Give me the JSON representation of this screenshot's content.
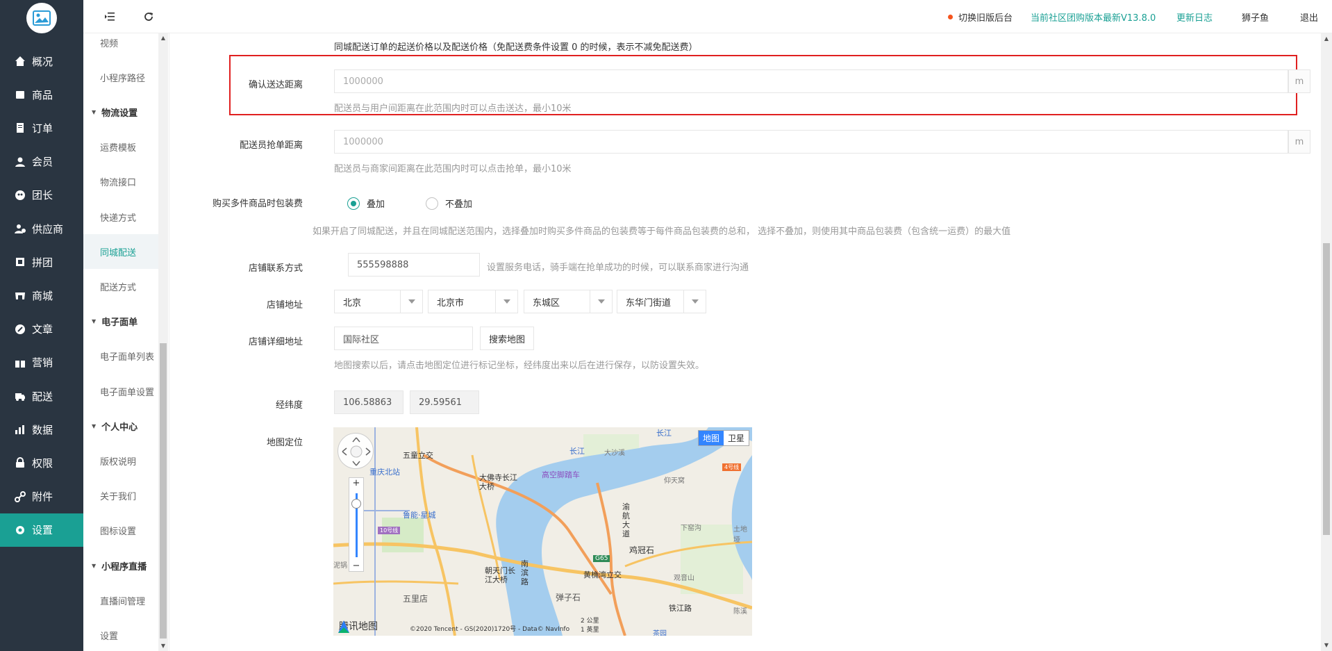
{
  "sidebar": {
    "items": [
      {
        "label": "概况",
        "icon": "home-icon"
      },
      {
        "label": "商品",
        "icon": "goods-icon"
      },
      {
        "label": "订单",
        "icon": "order-icon"
      },
      {
        "label": "会员",
        "icon": "user-icon"
      },
      {
        "label": "团长",
        "icon": "leader-icon"
      },
      {
        "label": "供应商",
        "icon": "supplier-icon"
      },
      {
        "label": "拼团",
        "icon": "group-icon"
      },
      {
        "label": "商城",
        "icon": "store-icon"
      },
      {
        "label": "文章",
        "icon": "article-icon"
      },
      {
        "label": "营销",
        "icon": "gift-icon"
      },
      {
        "label": "配送",
        "icon": "truck-icon"
      },
      {
        "label": "数据",
        "icon": "chart-icon"
      },
      {
        "label": "权限",
        "icon": "lock-icon"
      },
      {
        "label": "附件",
        "icon": "link-icon"
      },
      {
        "label": "设置",
        "icon": "gear-icon"
      }
    ],
    "active": "设置"
  },
  "submenu": {
    "items": [
      {
        "label": "视频",
        "type": "item"
      },
      {
        "label": "小程序路径",
        "type": "item"
      },
      {
        "label": "物流设置",
        "type": "group"
      },
      {
        "label": "运费模板",
        "type": "item"
      },
      {
        "label": "物流接口",
        "type": "item"
      },
      {
        "label": "快递方式",
        "type": "item"
      },
      {
        "label": "同城配送",
        "type": "item"
      },
      {
        "label": "配送方式",
        "type": "item"
      },
      {
        "label": "电子面单",
        "type": "group"
      },
      {
        "label": "电子面单列表",
        "type": "item"
      },
      {
        "label": "电子面单设置",
        "type": "item"
      },
      {
        "label": "个人中心",
        "type": "group"
      },
      {
        "label": "版权说明",
        "type": "item"
      },
      {
        "label": "关于我们",
        "type": "item"
      },
      {
        "label": "图标设置",
        "type": "item"
      },
      {
        "label": "小程序直播",
        "type": "group"
      },
      {
        "label": "直播间管理",
        "type": "item"
      },
      {
        "label": "设置",
        "type": "item"
      }
    ],
    "active": "同城配送"
  },
  "header": {
    "switch_old": "切换旧版后台",
    "version": "当前社区团购版本最新V13.8.0",
    "changelog": "更新日志",
    "username": "狮子鱼",
    "logout": "退出"
  },
  "form": {
    "top_hint": "同城配送订单的起送价格以及配送价格（免配送费条件设置 0 的时候，表示不减免配送费）",
    "confirm_distance": {
      "label": "确认送达距离",
      "placeholder": "1000000",
      "suffix": "m",
      "hint": "配送员与用户间距离在此范围内时可以点击送达，最小10米"
    },
    "grab_distance": {
      "label": "配送员抢单距离",
      "placeholder": "1000000",
      "suffix": "m",
      "hint": "配送员与商家间距离在此范围内时可以点击抢单，最小10米"
    },
    "packing": {
      "label": "购买多件商品时包装费",
      "options": [
        "叠加",
        "不叠加"
      ],
      "selected": "叠加",
      "hint": "如果开启了同城配送，并且在同城配送范围内，选择叠加时购买多件商品的包装费等于每件商品包装费的总和， 选择不叠加，则使用其中商品包装费（包含统一运费）的最大值"
    },
    "contact": {
      "label": "店铺联系方式",
      "value": "555598888",
      "hint": "设置服务电话，骑手端在抢单成功的时候，可以联系商家进行沟通"
    },
    "address": {
      "label": "店铺地址",
      "province": "北京",
      "city": "北京市",
      "district": "东城区",
      "street": "东华门街道"
    },
    "detail_address": {
      "label": "店铺详细地址",
      "value": "国际社区",
      "search_button": "搜索地图",
      "hint": "地图搜索以后，请点击地图定位进行标记坐标，经纬度出来以后在进行保存，以防设置失效。"
    },
    "latlng": {
      "label": "经纬度",
      "lng": "106.58863",
      "lat": "29.59561"
    },
    "map": {
      "label": "地图定位",
      "tab_map": "地图",
      "tab_satellite": "卫星",
      "logo": "腾讯地图",
      "copyright": "©2020 Tencent - GS(2020)1720号 - Data© NavInfo",
      "scale_top": "2 公里",
      "scale_bottom": "1 英里",
      "places": [
        "五童立交",
        "重庆北站",
        "大佛寺长江大桥",
        "高空脚踏车",
        "大沙溪",
        "鲁能·星城",
        "渝航大道",
        "鸡冠石",
        "朝天门长江大桥",
        "南滨路",
        "黄桷湾立交",
        "弹子石",
        "五里店",
        "长江",
        "长江",
        "G65",
        "10号线",
        "4号线",
        "仰天窝",
        "下窑沟",
        "土地垭",
        "观音山",
        "铁江路",
        "陈溪",
        "泥锅",
        "茶园"
      ]
    }
  },
  "colors": {
    "sidebar_bg": "#2a3541",
    "accent": "#1aa094",
    "highlight": "#e02020",
    "link": "#1aa094"
  }
}
